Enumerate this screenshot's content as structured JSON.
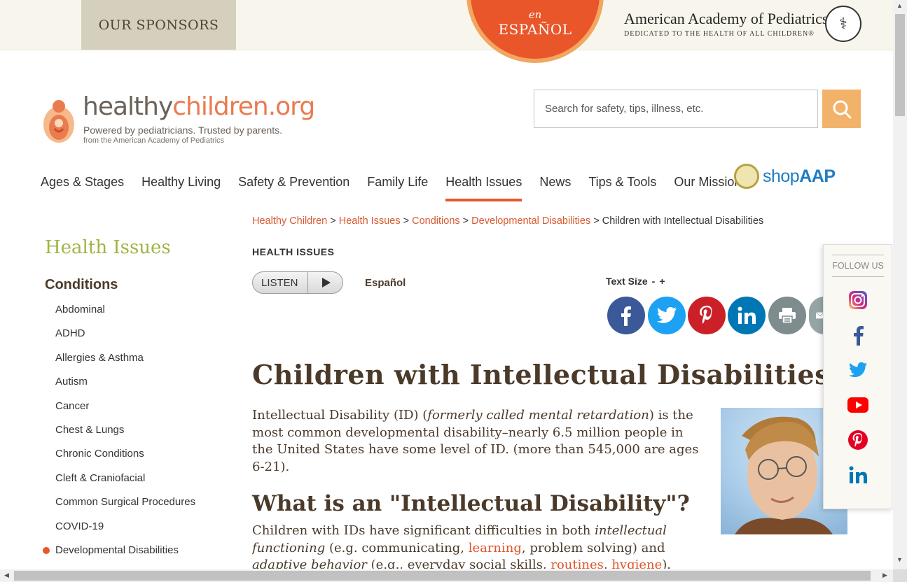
{
  "topbar": {
    "sponsors_label": "OUR SPONSORS",
    "espanol_en": "en",
    "espanol_label": "ESPAÑOL",
    "aap_title": "American Academy of Pediatrics",
    "aap_tagline": "DEDICATED TO THE HEALTH OF ALL CHILDREN®"
  },
  "logo": {
    "word_main": "healthy",
    "word_accent": "children.org",
    "tagline": "Powered by pediatricians. Trusted by parents.",
    "subline": "from the American Academy of Pediatrics"
  },
  "search": {
    "placeholder": "Search for safety, tips, illness, etc."
  },
  "nav": {
    "items": [
      "Ages & Stages",
      "Healthy Living",
      "Safety & Prevention",
      "Family Life",
      "Health Issues",
      "News",
      "Tips & Tools",
      "Our Mission"
    ],
    "active": "Health Issues",
    "shop_a": "shop",
    "shop_b": "AAP"
  },
  "sidebar": {
    "title": "Health Issues",
    "section": "Conditions",
    "items": [
      "Abdominal",
      "ADHD",
      "Allergies & Asthma",
      "Autism",
      "Cancer",
      "Chest & Lungs",
      "Chronic Conditions",
      "Cleft & Craniofacial",
      "Common Surgical Procedures",
      "COVID-19",
      "Developmental Disabilities"
    ],
    "current": "Developmental Disabilities"
  },
  "breadcrumb": {
    "items": [
      "Healthy Children",
      "Health Issues",
      "Conditions",
      "Developmental Disabilities"
    ],
    "separator": ">",
    "current": "Children with Intellectual Disabilities"
  },
  "toolbar": {
    "section_label": "HEALTH ISSUES",
    "listen_label": "LISTEN",
    "espanol_link": "Español",
    "text_size_label": "Text Size",
    "text_size_minus": "-",
    "text_size_plus": "+"
  },
  "share": {
    "buttons": [
      {
        "icon": "facebook-icon",
        "color": "#3b5998"
      },
      {
        "icon": "twitter-icon",
        "color": "#1da1f2"
      },
      {
        "icon": "pinterest-icon",
        "color": "#cb2027"
      },
      {
        "icon": "linkedin-icon",
        "color": "#0077b5"
      },
      {
        "icon": "print-icon",
        "color": "#7f8c8d"
      },
      {
        "icon": "email-icon",
        "color": "#95a5a6"
      }
    ]
  },
  "article": {
    "title": "Children with Intellectual Disabilities",
    "intro_1": "Intellectual Disability (ID) (",
    "intro_italic": "formerly called mental retardation",
    "intro_2": ") is the most common developmental disability–nearly 6.5 million people in the United States have some level of ID. (more than 545,000 are ages 6-21).",
    "h2": "What is an \"Intellectual Disability\"?",
    "p2_1": "Children with IDs have significant difficulties in both ",
    "p2_italic_1": "intellectual functioning",
    "p2_2": " (e.g. communicating, ",
    "p2_link_1": "learning",
    "p2_3": ", problem solving) and ",
    "p2_italic_2": "adaptive behavior",
    "p2_4": " (e.g., everyday social skills, ",
    "p2_link_2": "routines",
    "p2_5": ", ",
    "p2_link_3": "hygiene",
    "p2_6": ")."
  },
  "follow": {
    "label": "FOLLOW US",
    "icons": [
      "instagram-icon",
      "facebook-icon",
      "twitter-icon",
      "youtube-icon",
      "pinterest-icon",
      "linkedin-icon"
    ]
  },
  "colors": {
    "accent": "#e8562a",
    "sidebar_title": "#9eb544",
    "search_button": "#f3b26a"
  }
}
